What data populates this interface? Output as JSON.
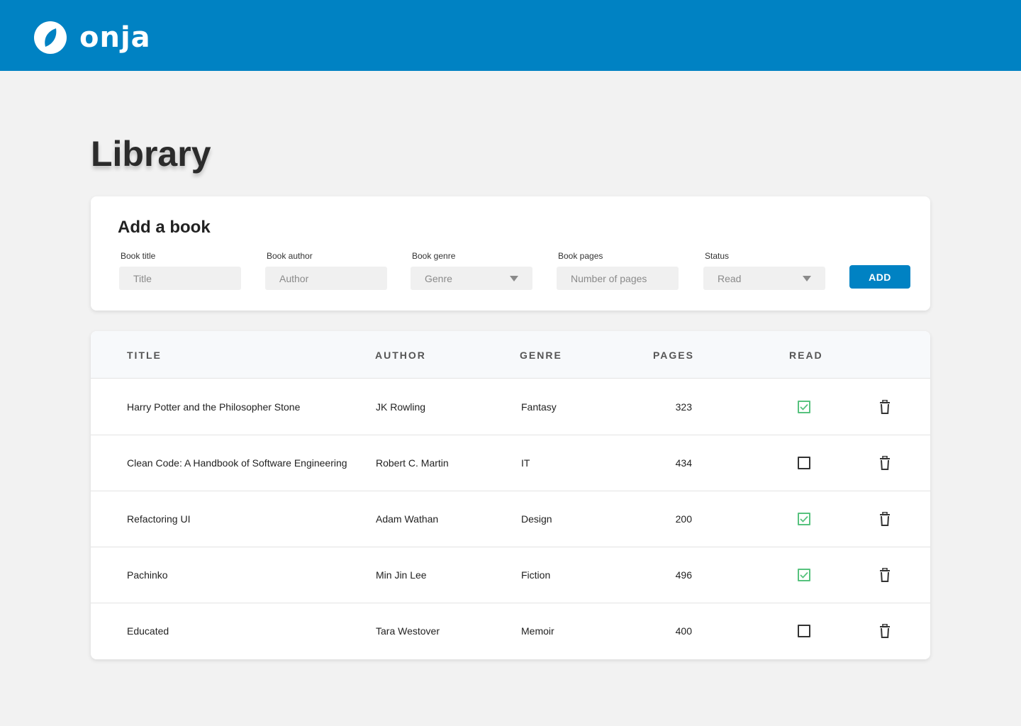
{
  "brand": {
    "name": "onja",
    "accent": "#0082c3"
  },
  "page": {
    "title": "Library"
  },
  "add_form": {
    "title": "Add a book",
    "fields": [
      {
        "label": "Book title",
        "placeholder": "Title",
        "type": "text"
      },
      {
        "label": "Book author",
        "placeholder": "Author",
        "type": "text"
      },
      {
        "label": "Book genre",
        "value": "Genre",
        "type": "select"
      },
      {
        "label": "Book pages",
        "placeholder": "Number of pages",
        "type": "text"
      },
      {
        "label": "Status",
        "value": "Read",
        "type": "select"
      }
    ],
    "button_label": "ADD"
  },
  "table": {
    "headers": {
      "title": "TITLE",
      "author": "AUTHOR",
      "genre": "GENRE",
      "pages": "PAGES",
      "read": "READ"
    },
    "rows": [
      {
        "title": "Harry Potter and the Philosopher Stone",
        "author": "JK Rowling",
        "genre": "Fantasy",
        "pages": "323",
        "read": true
      },
      {
        "title": "Clean Code: A Handbook of Software Engineering",
        "author": "Robert C. Martin",
        "genre": "IT",
        "pages": "434",
        "read": false
      },
      {
        "title": "Refactoring UI",
        "author": "Adam Wathan",
        "genre": "Design",
        "pages": "200",
        "read": true
      },
      {
        "title": "Pachinko",
        "author": "Min Jin Lee",
        "genre": "Fiction",
        "pages": "496",
        "read": true
      },
      {
        "title": "Educated",
        "author": "Tara Westover",
        "genre": "Memoir",
        "pages": "400",
        "read": false
      }
    ],
    "check_color": "#57c27e",
    "delete_icon": "trash-icon"
  }
}
